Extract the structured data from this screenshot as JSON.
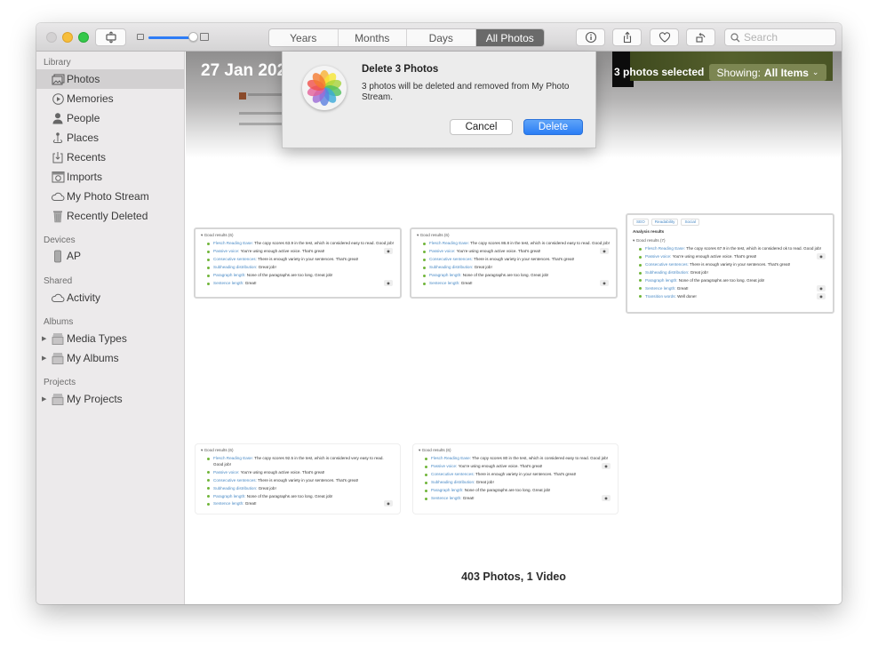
{
  "toolbar": {
    "tabs": [
      {
        "label": "Years",
        "active": false
      },
      {
        "label": "Months",
        "active": false
      },
      {
        "label": "Days",
        "active": false
      },
      {
        "label": "All Photos",
        "active": true
      }
    ],
    "search_placeholder": "Search",
    "search_value": "",
    "icons": {
      "sidebar_toggle": "sidebar-toggle-icon",
      "info": "info-icon",
      "share": "share-icon",
      "favorite": "heart-icon",
      "rotate": "rotate-icon",
      "search": "search-icon"
    },
    "zoom_slider_value": 0.85
  },
  "sidebar": {
    "sections": [
      {
        "header": "Library",
        "items": [
          {
            "label": "Photos",
            "icon": "photos-icon",
            "selected": true
          },
          {
            "label": "Memories",
            "icon": "memories-icon"
          },
          {
            "label": "People",
            "icon": "person-icon"
          },
          {
            "label": "Places",
            "icon": "pin-icon"
          },
          {
            "label": "Recents",
            "icon": "recents-icon"
          },
          {
            "label": "Imports",
            "icon": "camera-icon"
          },
          {
            "label": "My Photo Stream",
            "icon": "cloud-icon"
          },
          {
            "label": "Recently Deleted",
            "icon": "trash-icon"
          }
        ]
      },
      {
        "header": "Devices",
        "items": [
          {
            "label": "AP",
            "icon": "phone-icon"
          }
        ]
      },
      {
        "header": "Shared",
        "items": [
          {
            "label": "Activity",
            "icon": "cloud-icon"
          }
        ]
      },
      {
        "header": "Albums",
        "items": [
          {
            "label": "Media Types",
            "icon": "folder-icon",
            "expandable": true
          },
          {
            "label": "My Albums",
            "icon": "folder-icon",
            "expandable": true
          }
        ]
      },
      {
        "header": "Projects",
        "items": [
          {
            "label": "My Projects",
            "icon": "folder-icon",
            "expandable": true
          }
        ]
      }
    ]
  },
  "main": {
    "date_title": "27 Jan 202",
    "selection_text": "3 photos selected",
    "showing_label": "Showing:",
    "showing_value": "All Items",
    "footer_count": "403 Photos, 1 Video",
    "thumbs": [
      {
        "group": "Good results (6)",
        "rows": [
          {
            "k": "Flesch Reading Ease:",
            "v": "The copy scores 63.9 in the test, which is considered easy to read. Good job!"
          },
          {
            "k": "Passive voice:",
            "v": "You're using enough active voice. That's great!",
            "eye": true
          },
          {
            "k": "Consecutive sentences:",
            "v": "There is enough variety in your sentences. That's great!"
          },
          {
            "k": "Subheading distribution:",
            "v": "Great job!"
          },
          {
            "k": "Paragraph length:",
            "v": "None of the paragraphs are too long. Great job!"
          },
          {
            "k": "Sentence length:",
            "v": "Great!",
            "eye": true
          }
        ]
      },
      {
        "group": "Good results (6)",
        "rows": [
          {
            "k": "Flesch Reading Ease:",
            "v": "The copy scores 86.8 in the test, which is considered easy to read. Good job!"
          },
          {
            "k": "Passive voice:",
            "v": "You're using enough active voice. That's great!",
            "eye": true
          },
          {
            "k": "Consecutive sentences:",
            "v": "There is enough variety in your sentences. That's great!"
          },
          {
            "k": "Subheading distribution:",
            "v": "Great job!"
          },
          {
            "k": "Paragraph length:",
            "v": "None of the paragraphs are too long. Great job!"
          },
          {
            "k": "Sentence length:",
            "v": "Great!",
            "eye": true
          }
        ]
      },
      {
        "tabs": [
          "SEO",
          "Readability",
          "Social"
        ],
        "analysis": "Analysis results",
        "group": "Good results (7)",
        "rows": [
          {
            "k": "Flesch Reading Ease:",
            "v": "The copy scores 67.9 in the test, which is considered ok to read. Good job!"
          },
          {
            "k": "Passive voice:",
            "v": "You're using enough active voice. That's great!",
            "eye": true
          },
          {
            "k": "Consecutive sentences:",
            "v": "There is enough variety in your sentences. That's great!"
          },
          {
            "k": "Subheading distribution:",
            "v": "Great job!"
          },
          {
            "k": "Paragraph length:",
            "v": "None of the paragraphs are too long. Great job!"
          },
          {
            "k": "Sentence length:",
            "v": "Great!",
            "eye": true
          },
          {
            "k": "Transition words:",
            "v": "Well done!",
            "eye": true
          }
        ]
      },
      {
        "group": "Good results (6)",
        "rows": [
          {
            "k": "Flesch Reading Ease:",
            "v": "The copy scores 92.5 in the test, which is considered very easy to read. Good job!"
          },
          {
            "k": "Passive voice:",
            "v": "You're using enough active voice. That's great!"
          },
          {
            "k": "Consecutive sentences:",
            "v": "There is enough variety in your sentences. That's great!"
          },
          {
            "k": "Subheading distribution:",
            "v": "Great job!"
          },
          {
            "k": "Paragraph length:",
            "v": "None of the paragraphs are too long. Great job!"
          },
          {
            "k": "Sentence length:",
            "v": "Great!",
            "eye": true
          }
        ]
      },
      {
        "group": "Good results (6)",
        "rows": [
          {
            "k": "Flesch Reading Ease:",
            "v": "The copy scores 80 in the test, which is considered easy to read. Good job!"
          },
          {
            "k": "Passive voice:",
            "v": "You're using enough active voice. That's great!",
            "eye": true
          },
          {
            "k": "Consecutive sentences:",
            "v": "There is enough variety in your sentences. That's great!"
          },
          {
            "k": "Subheading distribution:",
            "v": "Great job!"
          },
          {
            "k": "Paragraph length:",
            "v": "None of the paragraphs are too long. Great job!"
          },
          {
            "k": "Sentence length:",
            "v": "Great!",
            "eye": true
          }
        ]
      }
    ]
  },
  "dialog": {
    "title": "Delete 3 Photos",
    "message": "3 photos will be deleted and removed from My Photo Stream.",
    "cancel_label": "Cancel",
    "delete_label": "Delete",
    "icon": "photos-app-icon"
  },
  "colors": {
    "accent": "#2a7df5",
    "active_segment": "#6a6a6a",
    "showing_badge": "#7c8652",
    "good_bullet": "#70b53a",
    "link": "#4b8bc6"
  }
}
